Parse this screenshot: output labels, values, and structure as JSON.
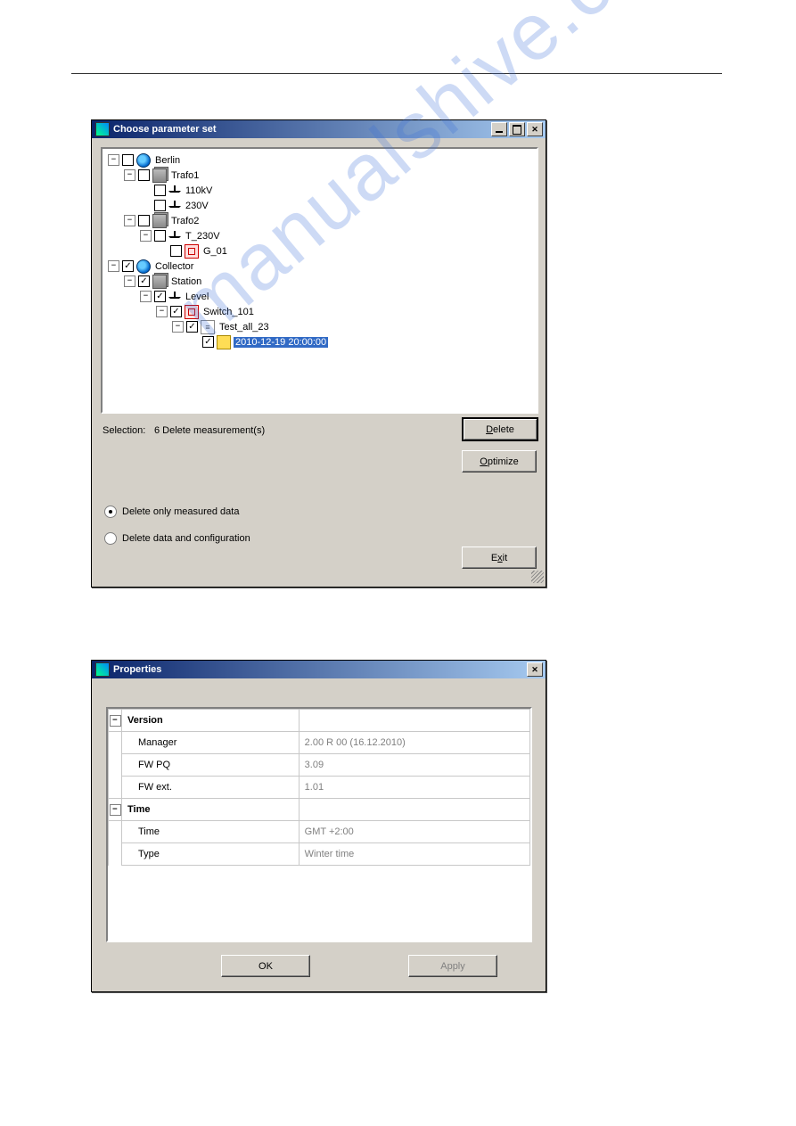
{
  "watermark": "manualshive.com",
  "dialog1": {
    "title": "Choose parameter set",
    "selection_label": "Selection:",
    "selection_value": "6 Delete measurement(s)",
    "btn_delete": "Delete",
    "delete_underline": "D",
    "btn_optimize": "Optimize",
    "optimize_underline": "O",
    "btn_exit": "Exit",
    "exit_underline": "x",
    "radio1": "Delete only measured data",
    "radio2": "Delete data and configuration",
    "tree": [
      {
        "indent": 0,
        "exp": "-",
        "chk": false,
        "icon": "globe",
        "label": "Berlin"
      },
      {
        "indent": 1,
        "exp": "-",
        "chk": false,
        "icon": "stack",
        "label": "Trafo1"
      },
      {
        "indent": 2,
        "exp": "",
        "chk": false,
        "icon": "tower",
        "label": "110kV"
      },
      {
        "indent": 2,
        "exp": "",
        "chk": false,
        "icon": "tower",
        "label": "230V"
      },
      {
        "indent": 1,
        "exp": "-",
        "chk": false,
        "icon": "stack",
        "label": "Trafo2"
      },
      {
        "indent": 2,
        "exp": "-",
        "chk": false,
        "icon": "tower",
        "label": "T_230V"
      },
      {
        "indent": 3,
        "exp": "",
        "chk": false,
        "icon": "red",
        "label": "G_01"
      },
      {
        "indent": 0,
        "exp": "-",
        "chk": true,
        "icon": "globe",
        "label": "Collector"
      },
      {
        "indent": 1,
        "exp": "-",
        "chk": true,
        "icon": "stack",
        "label": "Station"
      },
      {
        "indent": 2,
        "exp": "-",
        "chk": true,
        "icon": "tower",
        "label": "Level"
      },
      {
        "indent": 3,
        "exp": "-",
        "chk": true,
        "icon": "red",
        "label": "Switch_101"
      },
      {
        "indent": 4,
        "exp": "-",
        "chk": true,
        "icon": "doc",
        "label": "Test_all_23"
      },
      {
        "indent": 5,
        "exp": "",
        "chk": true,
        "icon": "folder",
        "label": "2010-12-19 20:00:00",
        "sel": true
      }
    ]
  },
  "dialog2": {
    "title": "Properties",
    "sections": [
      {
        "name": "Version",
        "rows": [
          {
            "label": "Manager",
            "value": "2.00 R 00 (16.12.2010)"
          },
          {
            "label": "FW PQ",
            "value": "3.09"
          },
          {
            "label": "FW ext.",
            "value": "1.01"
          }
        ]
      },
      {
        "name": "Time",
        "rows": [
          {
            "label": "Time",
            "value": "GMT +2:00"
          },
          {
            "label": "Type",
            "value": "Winter time"
          }
        ]
      }
    ],
    "btn_ok": "OK",
    "btn_apply": "Apply"
  }
}
